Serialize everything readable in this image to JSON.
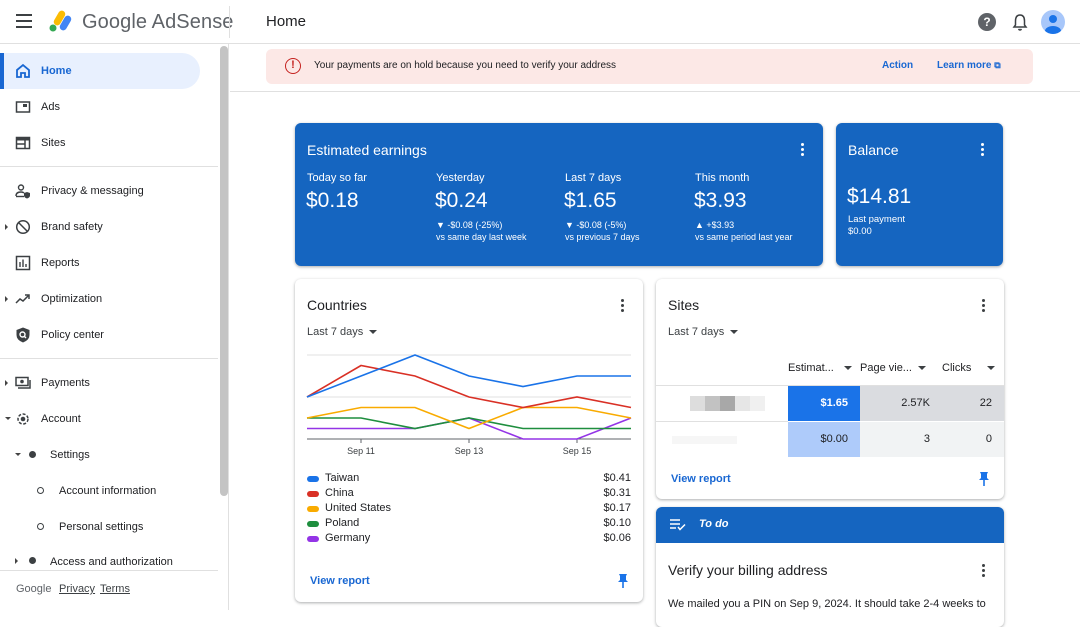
{
  "header": {
    "app_name": "Google AdSense",
    "page_title": "Home",
    "icons": [
      "menu-icon",
      "help-icon",
      "notifications-icon",
      "account-avatar"
    ]
  },
  "sidebar": {
    "items": [
      {
        "label": "Home",
        "icon": "home-icon",
        "active": true
      },
      {
        "label": "Ads",
        "icon": "ads-icon"
      },
      {
        "label": "Sites",
        "icon": "sites-icon"
      },
      {
        "label": "Privacy & messaging",
        "icon": "privacy-icon"
      },
      {
        "label": "Brand safety",
        "icon": "block-icon",
        "expandable": true
      },
      {
        "label": "Reports",
        "icon": "reports-icon"
      },
      {
        "label": "Optimization",
        "icon": "trending-icon",
        "expandable": true
      },
      {
        "label": "Policy center",
        "icon": "policy-icon"
      },
      {
        "label": "Payments",
        "icon": "payments-icon",
        "expandable": true
      },
      {
        "label": "Account",
        "icon": "settings-gear-icon",
        "expanded": true
      },
      {
        "label": "Settings",
        "expanded": true
      },
      {
        "label": "Account information"
      },
      {
        "label": "Personal settings"
      },
      {
        "label": "Access and authorization",
        "expandable": true
      }
    ],
    "footer": {
      "brand": "Google",
      "privacy": "Privacy",
      "terms": "Terms"
    }
  },
  "alert": {
    "message": "Your payments are on hold because you need to verify your address",
    "action_label": "Action",
    "learn_more_label": "Learn more"
  },
  "earnings": {
    "title": "Estimated earnings",
    "metrics": [
      {
        "label": "Today so far",
        "value": "$0.18",
        "delta": "",
        "compare": ""
      },
      {
        "label": "Yesterday",
        "value": "$0.24",
        "delta": "▼ -$0.08 (-25%)",
        "compare": "vs same day last week"
      },
      {
        "label": "Last 7 days",
        "value": "$1.65",
        "delta": "▼ -$0.08 (-5%)",
        "compare": "vs previous 7 days"
      },
      {
        "label": "This month",
        "value": "$3.93",
        "delta": "▲ +$3.93",
        "compare": "vs same period last year"
      }
    ]
  },
  "balance": {
    "title": "Balance",
    "value": "$14.81",
    "last_payment_label": "Last payment",
    "last_payment_value": "$0.00"
  },
  "countries": {
    "title": "Countries",
    "range": "Last 7 days",
    "view_report": "View report",
    "legend": [
      {
        "name": "Taiwan",
        "value": "$0.41",
        "color": "#1a73e8"
      },
      {
        "name": "China",
        "value": "$0.31",
        "color": "#d93025"
      },
      {
        "name": "United States",
        "value": "$0.17",
        "color": "#f9ab00"
      },
      {
        "name": "Poland",
        "value": "$0.10",
        "color": "#1e8e3e"
      },
      {
        "name": "Germany",
        "value": "$0.06",
        "color": "#9334e6"
      }
    ]
  },
  "chart_data": {
    "type": "line",
    "title": "Countries",
    "x": [
      "Sep 10",
      "Sep 11",
      "Sep 12",
      "Sep 13",
      "Sep 14",
      "Sep 15",
      "Sep 16"
    ],
    "tick_labels": [
      "Sep 11",
      "Sep 13",
      "Sep 15"
    ],
    "ylim": [
      0,
      0.08
    ],
    "grid": true,
    "legend_position": "bottom",
    "series": [
      {
        "name": "Taiwan",
        "color": "#1a73e8",
        "values": [
          0.04,
          0.06,
          0.08,
          0.06,
          0.05,
          0.06,
          0.06
        ]
      },
      {
        "name": "China",
        "color": "#d93025",
        "values": [
          0.04,
          0.07,
          0.06,
          0.04,
          0.03,
          0.04,
          0.03
        ]
      },
      {
        "name": "United States",
        "color": "#f9ab00",
        "values": [
          0.02,
          0.03,
          0.03,
          0.01,
          0.03,
          0.03,
          0.02
        ]
      },
      {
        "name": "Poland",
        "color": "#1e8e3e",
        "values": [
          0.02,
          0.02,
          0.01,
          0.02,
          0.01,
          0.01,
          0.01
        ]
      },
      {
        "name": "Germany",
        "color": "#9334e6",
        "values": [
          0.01,
          0.01,
          0.01,
          0.02,
          0.0,
          0.0,
          0.02
        ]
      }
    ]
  },
  "sites": {
    "title": "Sites",
    "range": "Last 7 days",
    "columns": [
      "Estimat...",
      "Page vie...",
      "Clicks"
    ],
    "rows": [
      {
        "site": "(blurred)",
        "earnings": "$1.65",
        "page_views": "2.57K",
        "clicks": "22"
      },
      {
        "site": "(blurred)",
        "earnings": "$0.00",
        "page_views": "3",
        "clicks": "0"
      }
    ],
    "view_report": "View report"
  },
  "todo": {
    "header": "To do",
    "title": "Verify your billing address",
    "body": "We mailed you a PIN on Sep 9, 2024. It should take 2-4 weeks to"
  }
}
